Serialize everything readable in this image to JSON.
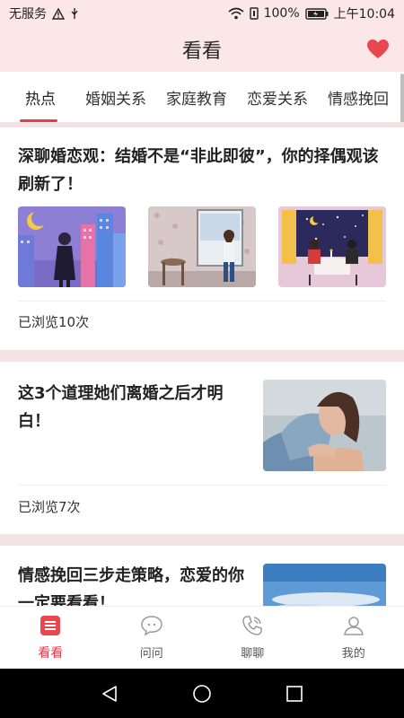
{
  "status_bar": {
    "carrier": "无服务",
    "battery": "100%",
    "time": "上午10:04"
  },
  "header": {
    "title": "看看"
  },
  "tabs": [
    {
      "label": "热点",
      "active": true
    },
    {
      "label": "婚姻关系",
      "active": false
    },
    {
      "label": "家庭教育",
      "active": false
    },
    {
      "label": "恋爱关系",
      "active": false
    },
    {
      "label": "情感挽回",
      "active": false
    }
  ],
  "articles": [
    {
      "title": "深聊婚恋观：结婚不是“非此即彼”，你的择偶观该刷新了！",
      "views": "已浏览10次"
    },
    {
      "title": "这3个道理她们离婚之后才明白！",
      "views": "已浏览7次"
    },
    {
      "title": "情感挽回三步走策略，恋爱的你一定要看看！"
    }
  ],
  "bottom_nav": [
    {
      "label": "看看",
      "icon": "list-icon",
      "active": true
    },
    {
      "label": "问问",
      "icon": "chat-bubble-icon",
      "active": false
    },
    {
      "label": "聊聊",
      "icon": "phone-icon",
      "active": false
    },
    {
      "label": "我的",
      "icon": "user-icon",
      "active": false
    }
  ],
  "colors": {
    "accent": "#e43c4b",
    "header_bg": "#fbe6e8",
    "separator": "#f3e3e6"
  }
}
